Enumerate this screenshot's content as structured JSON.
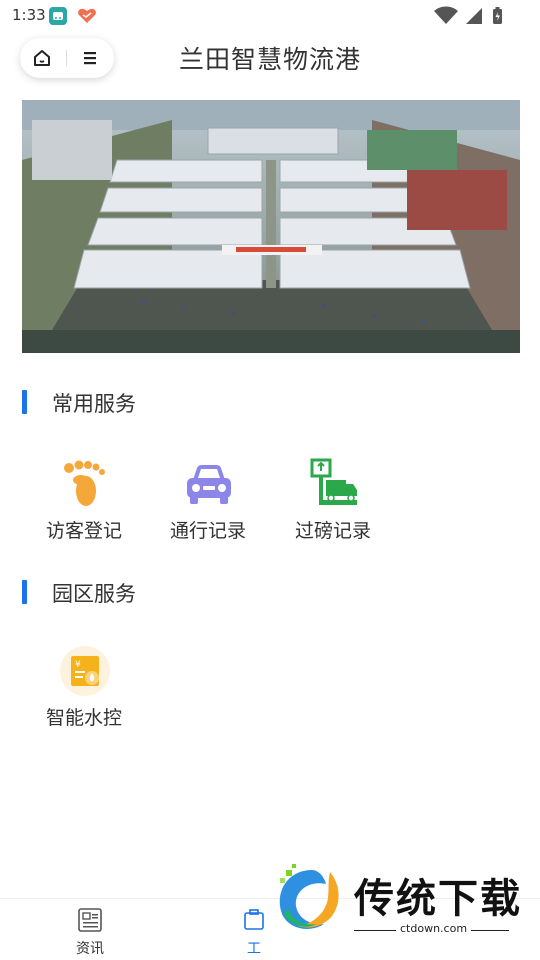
{
  "status_bar": {
    "time": "1:33"
  },
  "header": {
    "title": "兰田智慧物流港"
  },
  "sections": [
    {
      "title": "常用服务",
      "items": [
        {
          "label": "访客登记",
          "icon": "footprint-icon"
        },
        {
          "label": "通行记录",
          "icon": "car-icon"
        },
        {
          "label": "过磅记录",
          "icon": "truck-scale-icon"
        }
      ]
    },
    {
      "title": "园区服务",
      "items": [
        {
          "label": "智能水控",
          "icon": "water-bill-icon"
        }
      ]
    }
  ],
  "tabbar": {
    "tabs": [
      {
        "label": "资讯",
        "icon": "news-icon"
      },
      {
        "label": "工",
        "icon": "work-icon",
        "active": true
      }
    ]
  },
  "watermark": {
    "name": "传统下载",
    "site": "ctdown.com"
  },
  "colors": {
    "accent": "#1a73e8",
    "orange": "#f5a83a",
    "purple": "#8b86e8",
    "green": "#2aa84a"
  }
}
